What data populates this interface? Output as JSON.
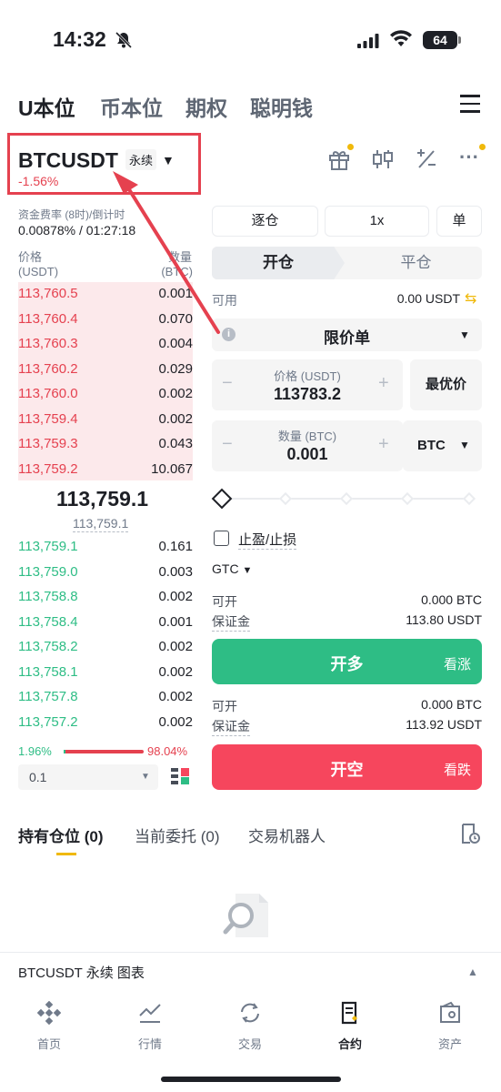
{
  "status_bar": {
    "time": "14:32",
    "battery": "64"
  },
  "top_tabs": [
    "U本位",
    "币本位",
    "期权",
    "聪明钱"
  ],
  "symbol": {
    "name": "BTCUSDT",
    "type": "永续",
    "change": "-1.56%"
  },
  "funding": {
    "label": "资金费率 (8时)/倒计时",
    "value": "0.00878% / 01:27:18"
  },
  "book": {
    "price_label": "价格",
    "price_unit": "(USDT)",
    "qty_label": "数量",
    "qty_unit": "(BTC)",
    "asks": [
      {
        "price": "113,760.5",
        "qty": "0.001"
      },
      {
        "price": "113,760.4",
        "qty": "0.070"
      },
      {
        "price": "113,760.3",
        "qty": "0.004"
      },
      {
        "price": "113,760.2",
        "qty": "0.029"
      },
      {
        "price": "113,760.0",
        "qty": "0.002"
      },
      {
        "price": "113,759.4",
        "qty": "0.002"
      },
      {
        "price": "113,759.3",
        "qty": "0.043"
      },
      {
        "price": "113,759.2",
        "qty": "10.067"
      }
    ],
    "mid_price": "113,759.1",
    "mark_price": "113,759.1",
    "bids": [
      {
        "price": "113,759.1",
        "qty": "0.161"
      },
      {
        "price": "113,759.0",
        "qty": "0.003"
      },
      {
        "price": "113,758.8",
        "qty": "0.002"
      },
      {
        "price": "113,758.4",
        "qty": "0.001"
      },
      {
        "price": "113,758.2",
        "qty": "0.002"
      },
      {
        "price": "113,758.1",
        "qty": "0.002"
      },
      {
        "price": "113,757.8",
        "qty": "0.002"
      },
      {
        "price": "113,757.2",
        "qty": "0.002"
      }
    ],
    "bid_ratio": "1.96%",
    "ask_ratio": "98.04%",
    "precision": "0.1"
  },
  "order": {
    "margin_mode": "逐仓",
    "leverage": "1x",
    "position_mode": "单",
    "tab_open": "开仓",
    "tab_close": "平仓",
    "available_label": "可用",
    "available_value": "0.00 USDT",
    "order_type": "限价单",
    "price_label": "价格 (USDT)",
    "price_value": "113783.2",
    "best_price": "最优价",
    "qty_label": "数量 (BTC)",
    "qty_value": "0.001",
    "qty_unit": "BTC",
    "tpsl": "止盈/止损",
    "tif": "GTC",
    "long": {
      "open_label": "可开",
      "open_value": "0.000 BTC",
      "margin_label": "保证金",
      "margin_value": "113.80 USDT",
      "button": "开多",
      "sub": "看涨"
    },
    "short": {
      "open_label": "可开",
      "open_value": "0.000 BTC",
      "margin_label": "保证金",
      "margin_value": "113.92 USDT",
      "button": "开空",
      "sub": "看跌"
    }
  },
  "bottom_tabs": [
    "持有仓位 (0)",
    "当前委托 (0)",
    "交易机器人"
  ],
  "chart_bar": "BTCUSDT 永续  图表",
  "nav": [
    "首页",
    "行情",
    "交易",
    "合约",
    "资产"
  ],
  "colors": {
    "accent": "#f0b90b",
    "buy": "#2ebd85",
    "sell": "#f6465d",
    "annotation": "#e5414f"
  }
}
